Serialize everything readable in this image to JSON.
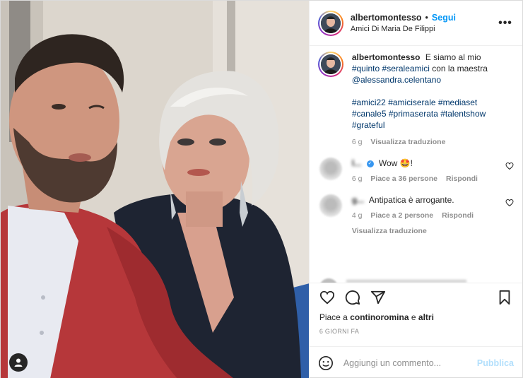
{
  "header": {
    "username": "albertomontesso",
    "separator": "•",
    "follow_label": "Segui",
    "location": "Amici Di Maria De Filippi",
    "more_label": "•••"
  },
  "caption": {
    "username": "albertomontesso",
    "text_before": "E siamo al mio",
    "hashtags_line1": [
      "#quinto",
      "#seraleamici"
    ],
    "text_middle": "con la maestra",
    "mention": "@alessandra.celentano",
    "hashtags_line2": [
      "#amici22",
      "#amiciserale",
      "#mediaset",
      "#canale5",
      "#primaserata",
      "#talentshow",
      "#grateful"
    ],
    "age": "6 g",
    "translate_label": "Visualizza traduzione"
  },
  "comments": [
    {
      "username": "l...",
      "verified": true,
      "text": "Wow 🤩!",
      "age": "6 g",
      "likes_label": "Piace a 36 persone",
      "reply_label": "Rispondi",
      "translate_label": ""
    },
    {
      "username": "g...",
      "verified": false,
      "text": "Antipatica è arrogante.",
      "age": "4 g",
      "likes_label": "Piace a 2 persone",
      "reply_label": "Rispondi",
      "translate_label": "Visualizza traduzione"
    }
  ],
  "actions": {
    "icons": [
      "heart-icon",
      "comment-icon",
      "share-icon",
      "bookmark-icon"
    ]
  },
  "likes": {
    "prefix": "Piace a",
    "user": "continoromina",
    "conjunction": "e",
    "others": "altri"
  },
  "date_label": "6 GIORNI FA",
  "composer": {
    "placeholder": "Aggiungi un commento...",
    "publish_label": "Pubblica"
  },
  "colors": {
    "link_blue": "#0095f6",
    "hashtag": "#00376b",
    "muted": "#8e8e8e",
    "publish_disabled": "#b2dffc"
  }
}
